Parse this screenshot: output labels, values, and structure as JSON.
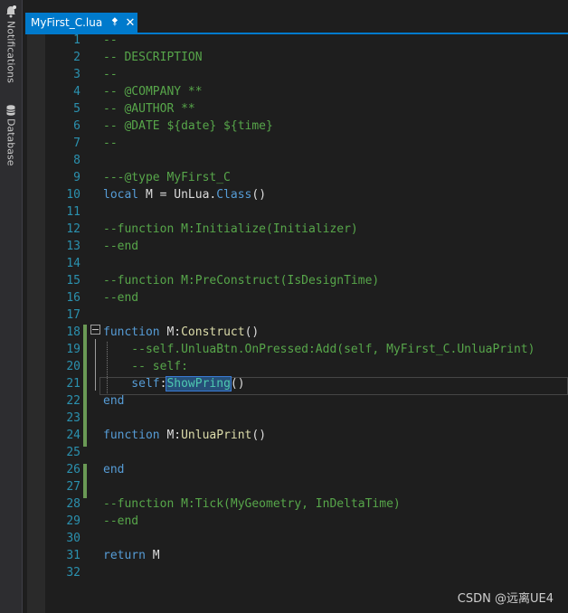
{
  "sidebar": {
    "notifications": "Notifications",
    "database": "Database"
  },
  "tab": {
    "title": "MyFirst_C.lua",
    "pin": "⯞",
    "close": "✕"
  },
  "lines": [
    {
      "n": "1",
      "segs": [
        {
          "c": "cm",
          "t": "--"
        }
      ]
    },
    {
      "n": "2",
      "segs": [
        {
          "c": "cm",
          "t": "-- DESCRIPTION"
        }
      ]
    },
    {
      "n": "3",
      "segs": [
        {
          "c": "cm",
          "t": "--"
        }
      ]
    },
    {
      "n": "4",
      "segs": [
        {
          "c": "cm",
          "t": "-- @COMPANY **"
        }
      ]
    },
    {
      "n": "5",
      "segs": [
        {
          "c": "cm",
          "t": "-- @AUTHOR **"
        }
      ]
    },
    {
      "n": "6",
      "segs": [
        {
          "c": "cm",
          "t": "-- @DATE ${date} ${time}"
        }
      ]
    },
    {
      "n": "7",
      "segs": [
        {
          "c": "cm",
          "t": "--"
        }
      ]
    },
    {
      "n": "8",
      "segs": []
    },
    {
      "n": "9",
      "segs": [
        {
          "c": "cm",
          "t": "---@type MyFirst_C"
        }
      ]
    },
    {
      "n": "10",
      "segs": [
        {
          "c": "kw",
          "t": "local"
        },
        {
          "c": "wt",
          "t": " M = UnLua."
        },
        {
          "c": "kw",
          "t": "Class"
        },
        {
          "c": "wt",
          "t": "()"
        }
      ]
    },
    {
      "n": "11",
      "segs": []
    },
    {
      "n": "12",
      "segs": [
        {
          "c": "cm",
          "t": "--function M:Initialize(Initializer)"
        }
      ]
    },
    {
      "n": "13",
      "segs": [
        {
          "c": "cm",
          "t": "--end"
        }
      ]
    },
    {
      "n": "14",
      "segs": []
    },
    {
      "n": "15",
      "segs": [
        {
          "c": "cm",
          "t": "--function M:PreConstruct(IsDesignTime)"
        }
      ]
    },
    {
      "n": "16",
      "segs": [
        {
          "c": "cm",
          "t": "--end"
        }
      ]
    },
    {
      "n": "17",
      "segs": []
    },
    {
      "n": "18",
      "segs": [
        {
          "c": "kw",
          "t": "function"
        },
        {
          "c": "wt",
          "t": " M:"
        },
        {
          "c": "dfn",
          "t": "Construct"
        },
        {
          "c": "wt",
          "t": "()"
        }
      ]
    },
    {
      "n": "19",
      "segs": [
        {
          "c": "cm",
          "t": "    --self.UnluaBtn.OnPressed:Add(self, MyFirst_C.UnluaPrint)"
        }
      ]
    },
    {
      "n": "20",
      "segs": [
        {
          "c": "cm",
          "t": "    -- self:"
        }
      ]
    },
    {
      "n": "21",
      "segs": [
        {
          "c": "kw",
          "t": "    self"
        },
        {
          "c": "wt",
          "t": ":"
        },
        {
          "c": "fn sel",
          "t": "ShowPring"
        },
        {
          "c": "wt",
          "t": "()"
        }
      ]
    },
    {
      "n": "22",
      "segs": [
        {
          "c": "kw",
          "t": "end"
        }
      ]
    },
    {
      "n": "23",
      "segs": []
    },
    {
      "n": "24",
      "segs": [
        {
          "c": "kw",
          "t": "function"
        },
        {
          "c": "wt",
          "t": " M:"
        },
        {
          "c": "dfn",
          "t": "UnluaPrint"
        },
        {
          "c": "wt",
          "t": "()"
        }
      ]
    },
    {
      "n": "25",
      "segs": []
    },
    {
      "n": "26",
      "segs": [
        {
          "c": "kw",
          "t": "end"
        }
      ]
    },
    {
      "n": "27",
      "segs": []
    },
    {
      "n": "28",
      "segs": [
        {
          "c": "cm",
          "t": "--function M:Tick(MyGeometry, InDeltaTime)"
        }
      ]
    },
    {
      "n": "29",
      "segs": [
        {
          "c": "cm",
          "t": "--end"
        }
      ]
    },
    {
      "n": "30",
      "segs": []
    },
    {
      "n": "31",
      "segs": [
        {
          "c": "kw",
          "t": "return"
        },
        {
          "c": "wt",
          "t": " M"
        }
      ]
    },
    {
      "n": "32",
      "segs": []
    }
  ],
  "watermark": "CSDN @远离UE4"
}
